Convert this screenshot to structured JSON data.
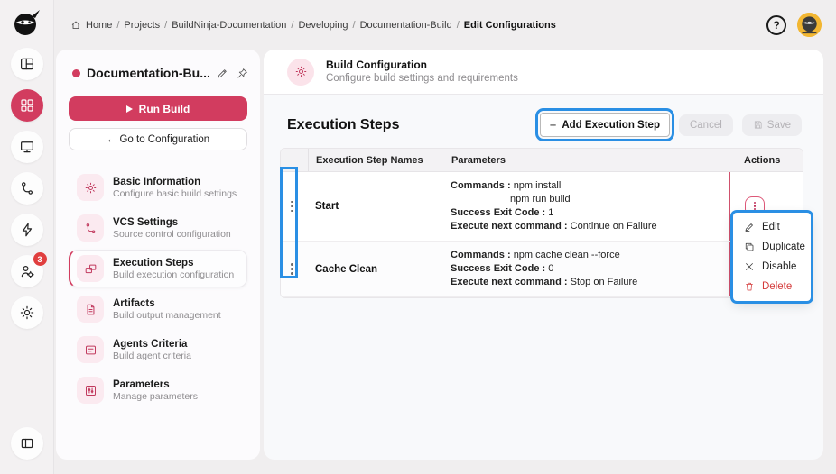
{
  "colors": {
    "accent": "#d23c5f",
    "annotation_blue": "#2a8fe4",
    "danger": "#d43a3a",
    "avatar_bg": "#f2b632",
    "badge_red": "#e03e3e"
  },
  "icons": {
    "plus": "+",
    "help": "?"
  },
  "breadcrumb": {
    "separator": "/",
    "items": [
      "Home",
      "Projects",
      "BuildNinja-Documentation",
      "Developing",
      "Documentation-Build",
      "Edit Configurations"
    ]
  },
  "rail": {
    "agents_badge": "3"
  },
  "sidebar": {
    "project_title": "Documentation-Bu...",
    "run_build_label": "Run Build",
    "goto_label": "← Go to Configuration",
    "items": [
      {
        "title": "Basic Information",
        "subtitle": "Configure basic build settings"
      },
      {
        "title": "VCS Settings",
        "subtitle": "Source control configuration"
      },
      {
        "title": "Execution Steps",
        "subtitle": "Build execution configuration"
      },
      {
        "title": "Artifacts",
        "subtitle": "Build output management"
      },
      {
        "title": "Agents Criteria",
        "subtitle": "Build agent criteria"
      },
      {
        "title": "Parameters",
        "subtitle": "Manage parameters"
      }
    ]
  },
  "main": {
    "header": {
      "title": "Build Configuration",
      "subtitle": "Configure build settings and requirements"
    },
    "section_title": "Execution Steps",
    "toolbar": {
      "add_label": "Add Execution Step",
      "cancel_label": "Cancel",
      "save_label": "Save"
    },
    "table": {
      "columns": {
        "name": "Execution Step Names",
        "params": "Parameters",
        "actions": "Actions"
      },
      "rows": [
        {
          "name": "Start",
          "params": [
            {
              "label": "Commands :",
              "value": "npm install"
            },
            {
              "label": "",
              "value": "npm run build"
            },
            {
              "label": "Success Exit Code :",
              "value": "1"
            },
            {
              "label": "Execute next command :",
              "value": "Continue on Failure"
            }
          ]
        },
        {
          "name": "Cache Clean",
          "params": [
            {
              "label": "Commands :",
              "value": "npm cache clean --force"
            },
            {
              "label": "Success Exit Code :",
              "value": "0"
            },
            {
              "label": "Execute next command :",
              "value": "Stop on Failure"
            }
          ]
        }
      ]
    },
    "context_menu": {
      "edit": "Edit",
      "duplicate": "Duplicate",
      "disable": "Disable",
      "delete": "Delete"
    }
  }
}
